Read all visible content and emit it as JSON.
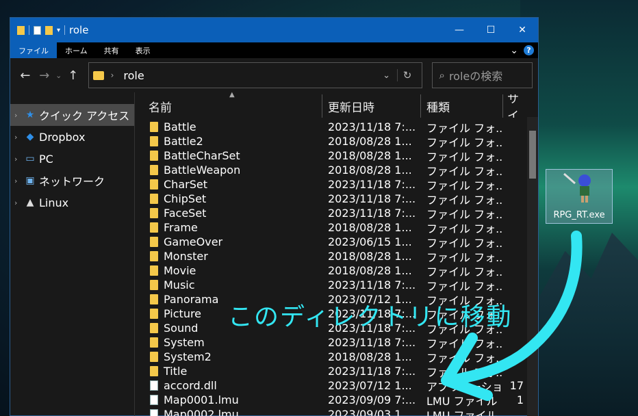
{
  "window": {
    "title": "role",
    "minimize_glyph": "—",
    "maximize_glyph": "☐",
    "close_glyph": "✕"
  },
  "ribbon": {
    "tabs": [
      "ファイル",
      "ホーム",
      "共有",
      "表示"
    ],
    "expand_glyph": "⌄",
    "help_glyph": "?"
  },
  "address": {
    "path_label": "role",
    "search_placeholder": "roleの検索"
  },
  "sidebar": {
    "items": [
      {
        "label": "クイック アクセス",
        "icon": "star-icon"
      },
      {
        "label": "Dropbox",
        "icon": "dropbox-icon"
      },
      {
        "label": "PC",
        "icon": "pc-icon"
      },
      {
        "label": "ネットワーク",
        "icon": "network-icon"
      },
      {
        "label": "Linux",
        "icon": "linux-icon"
      }
    ]
  },
  "columns": {
    "name": "名前",
    "date": "更新日時",
    "type": "種類",
    "size": "サイ"
  },
  "files": [
    {
      "name": "Battle",
      "date": "2023/11/18 7:...",
      "type": "ファイル フォ...",
      "size": "",
      "kind": "folder"
    },
    {
      "name": "Battle2",
      "date": "2018/08/28 1...",
      "type": "ファイル フォ...",
      "size": "",
      "kind": "folder"
    },
    {
      "name": "BattleCharSet",
      "date": "2018/08/28 1...",
      "type": "ファイル フォ...",
      "size": "",
      "kind": "folder"
    },
    {
      "name": "BattleWeapon",
      "date": "2018/08/28 1...",
      "type": "ファイル フォ...",
      "size": "",
      "kind": "folder"
    },
    {
      "name": "CharSet",
      "date": "2023/11/18 7:...",
      "type": "ファイル フォ...",
      "size": "",
      "kind": "folder"
    },
    {
      "name": "ChipSet",
      "date": "2023/11/18 7:...",
      "type": "ファイル フォ...",
      "size": "",
      "kind": "folder"
    },
    {
      "name": "FaceSet",
      "date": "2023/11/18 7:...",
      "type": "ファイル フォ...",
      "size": "",
      "kind": "folder"
    },
    {
      "name": "Frame",
      "date": "2018/08/28 1...",
      "type": "ファイル フォ...",
      "size": "",
      "kind": "folder"
    },
    {
      "name": "GameOver",
      "date": "2023/06/15 1...",
      "type": "ファイル フォ...",
      "size": "",
      "kind": "folder"
    },
    {
      "name": "Monster",
      "date": "2018/08/28 1...",
      "type": "ファイル フォ...",
      "size": "",
      "kind": "folder"
    },
    {
      "name": "Movie",
      "date": "2018/08/28 1...",
      "type": "ファイル フォ...",
      "size": "",
      "kind": "folder"
    },
    {
      "name": "Music",
      "date": "2023/11/18 7:...",
      "type": "ファイル フォ...",
      "size": "",
      "kind": "folder"
    },
    {
      "name": "Panorama",
      "date": "2023/07/12 1...",
      "type": "ファイル フォ...",
      "size": "",
      "kind": "folder"
    },
    {
      "name": "Picture",
      "date": "2023/11/18 7:...",
      "type": "ファイル フォ...",
      "size": "",
      "kind": "folder"
    },
    {
      "name": "Sound",
      "date": "2023/11/18 7:...",
      "type": "ファイル フォ...",
      "size": "",
      "kind": "folder"
    },
    {
      "name": "System",
      "date": "2023/11/18 7:...",
      "type": "ファイル フォ...",
      "size": "",
      "kind": "folder"
    },
    {
      "name": "System2",
      "date": "2018/08/28 1...",
      "type": "ファイル フォ...",
      "size": "",
      "kind": "folder"
    },
    {
      "name": "Title",
      "date": "2023/11/18 7:...",
      "type": "ファイル フォ...",
      "size": "",
      "kind": "folder"
    },
    {
      "name": "accord.dll",
      "date": "2023/07/12 1...",
      "type": "アプリケーショ...",
      "size": "17",
      "kind": "dll"
    },
    {
      "name": "Map0001.lmu",
      "date": "2023/09/09 7:...",
      "type": "LMU ファイル",
      "size": "1",
      "kind": "file"
    },
    {
      "name": "Map0002.lmu",
      "date": "2023/09/03 1...",
      "type": "LMU ファイル",
      "size": "",
      "kind": "file"
    }
  ],
  "desktop_icon": {
    "label": "RPG_RT.exe"
  },
  "annotation": {
    "text": "このディレクトリに移動",
    "color": "#33e6f2"
  },
  "colors": {
    "titlebar": "#0b5fb8",
    "window_bg": "#191919",
    "folder": "#f4c84a"
  }
}
